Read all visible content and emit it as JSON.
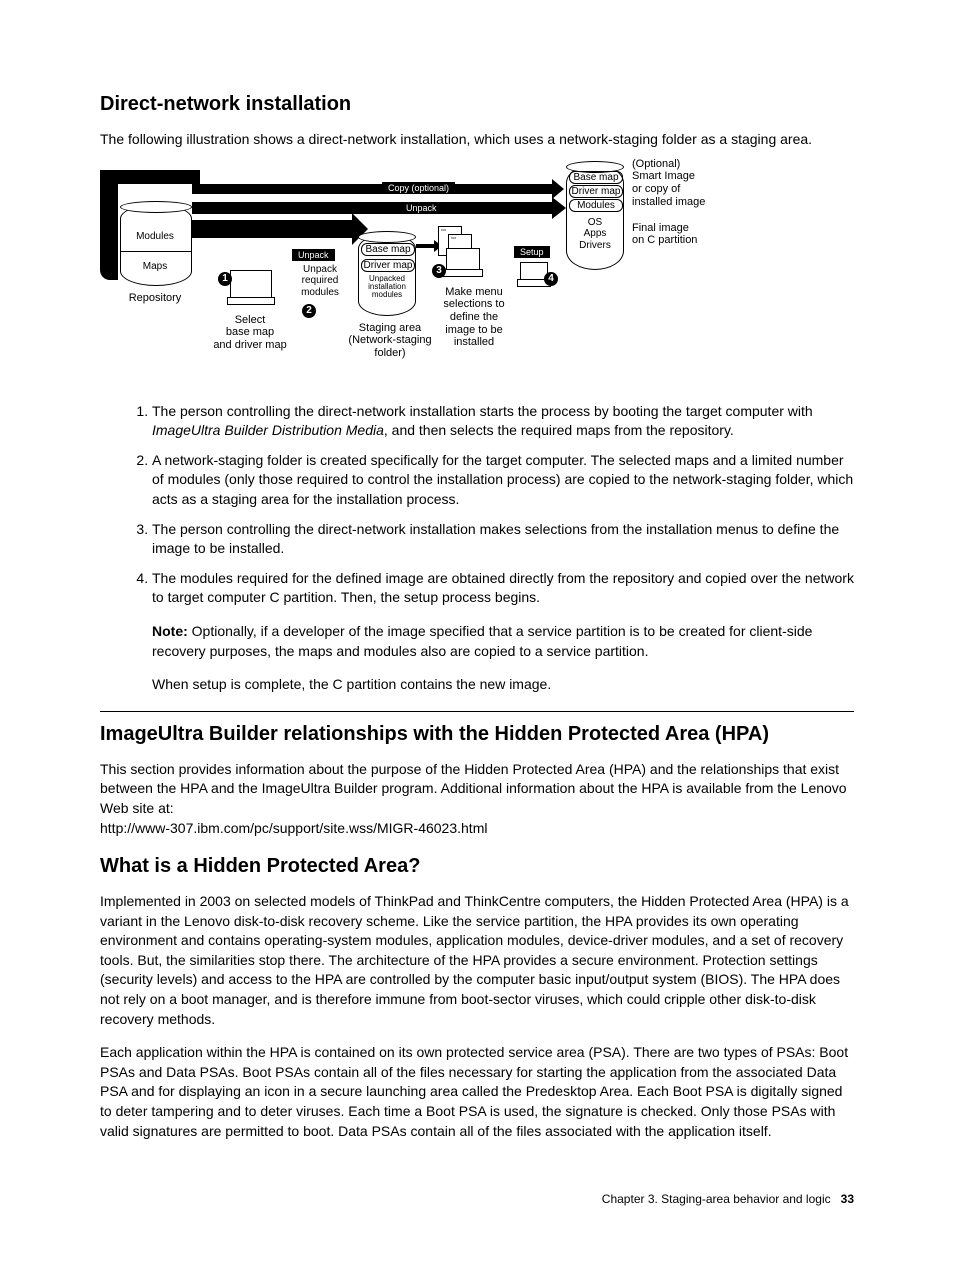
{
  "section1": {
    "heading": "Direct-network installation",
    "intro": "The following illustration shows a direct-network installation, which uses a network-staging folder as a staging area."
  },
  "diagram": {
    "repo_modules": "Modules",
    "repo_maps": "Maps",
    "repo_label": "Repository",
    "step1_caption": "Select\nbase map\nand driver map",
    "step2_box": "Unpack",
    "step2_sub": "Unpack\nrequired\nmodules",
    "staging_base": "Base map",
    "staging_driver": "Driver map",
    "staging_mods": "Unpacked\ninstallation\nmodules",
    "staging_caption": "Staging area\n(Network-staging\nfolder)",
    "arrow_copy": "Copy (optional)",
    "arrow_unpack": "Unpack",
    "step3_caption": "Make menu\nselections to\ndefine the\nimage to be\ninstalled",
    "setup_box": "Setup",
    "target_base": "Base map",
    "target_driver": "Driver map",
    "target_mods": "Modules",
    "target_os": "OS\nApps\nDrivers",
    "optional_caption": "(Optional)\nSmart Image\nor copy of\ninstalled image",
    "final_caption": "Final image\non C partition"
  },
  "steps": [
    {
      "text_a": "The person controlling the direct-network installation starts the process by booting the target computer with ",
      "em": "ImageUltra Builder Distribution Media",
      "text_b": ", and then selects the required maps from the repository."
    },
    {
      "text_a": "A network-staging folder is created specifically for the target computer. The selected maps and a limited number of modules (only those required to control the installation process) are copied to the network-staging folder, which acts as a staging area for the installation process.",
      "em": "",
      "text_b": ""
    },
    {
      "text_a": "The person controlling the direct-network installation makes selections from the installation menus to define the image to be installed.",
      "em": "",
      "text_b": ""
    },
    {
      "text_a": "The modules required for the defined image are obtained directly from the repository and copied over the network to target computer C partition. Then, the setup process begins.",
      "em": "",
      "text_b": ""
    }
  ],
  "note_label": "Note:",
  "note_text": " Optionally, if a developer of the image specified that a service partition is to be created for client-side recovery purposes, the maps and modules also are copied to a service partition.",
  "after_note": "When setup is complete, the C partition contains the new image.",
  "section2": {
    "heading": "ImageUltra Builder relationships with the Hidden Protected Area (HPA)",
    "para": "This section provides information about the purpose of the Hidden Protected Area (HPA) and the relationships that exist between the HPA and the ImageUltra Builder program. Additional information about the HPA is available from the Lenovo Web site at:",
    "url": "http://www-307.ibm.com/pc/support/site.wss/MIGR-46023.html"
  },
  "section3": {
    "heading": "What is a Hidden Protected Area?",
    "para1": "Implemented in 2003 on selected models of ThinkPad and ThinkCentre computers, the Hidden Protected Area (HPA) is a variant in the Lenovo disk-to-disk recovery scheme. Like the service partition, the HPA provides its own operating environment and contains operating-system modules, application modules, device-driver modules, and a set of recovery tools. But, the similarities stop there. The architecture of the HPA provides a secure environment. Protection settings (security levels) and access to the HPA are controlled by the computer basic input/output system (BIOS). The HPA does not rely on a boot manager, and is therefore immune from boot-sector viruses, which could cripple other disk-to-disk recovery methods.",
    "para2": "Each application within the HPA is contained on its own protected service area (PSA). There are two types of PSAs: Boot PSAs and Data PSAs. Boot PSAs contain all of the files necessary for starting the application from the associated Data PSA and for displaying an icon in a secure launching area called the Predesktop Area. Each Boot PSA is digitally signed to deter tampering and to deter viruses. Each time a Boot PSA is used, the signature is checked. Only those PSAs with valid signatures are permitted to boot. Data PSAs contain all of the files associated with the application itself."
  },
  "footer": {
    "chapter": "Chapter 3. Staging-area behavior and logic",
    "page": "33"
  }
}
